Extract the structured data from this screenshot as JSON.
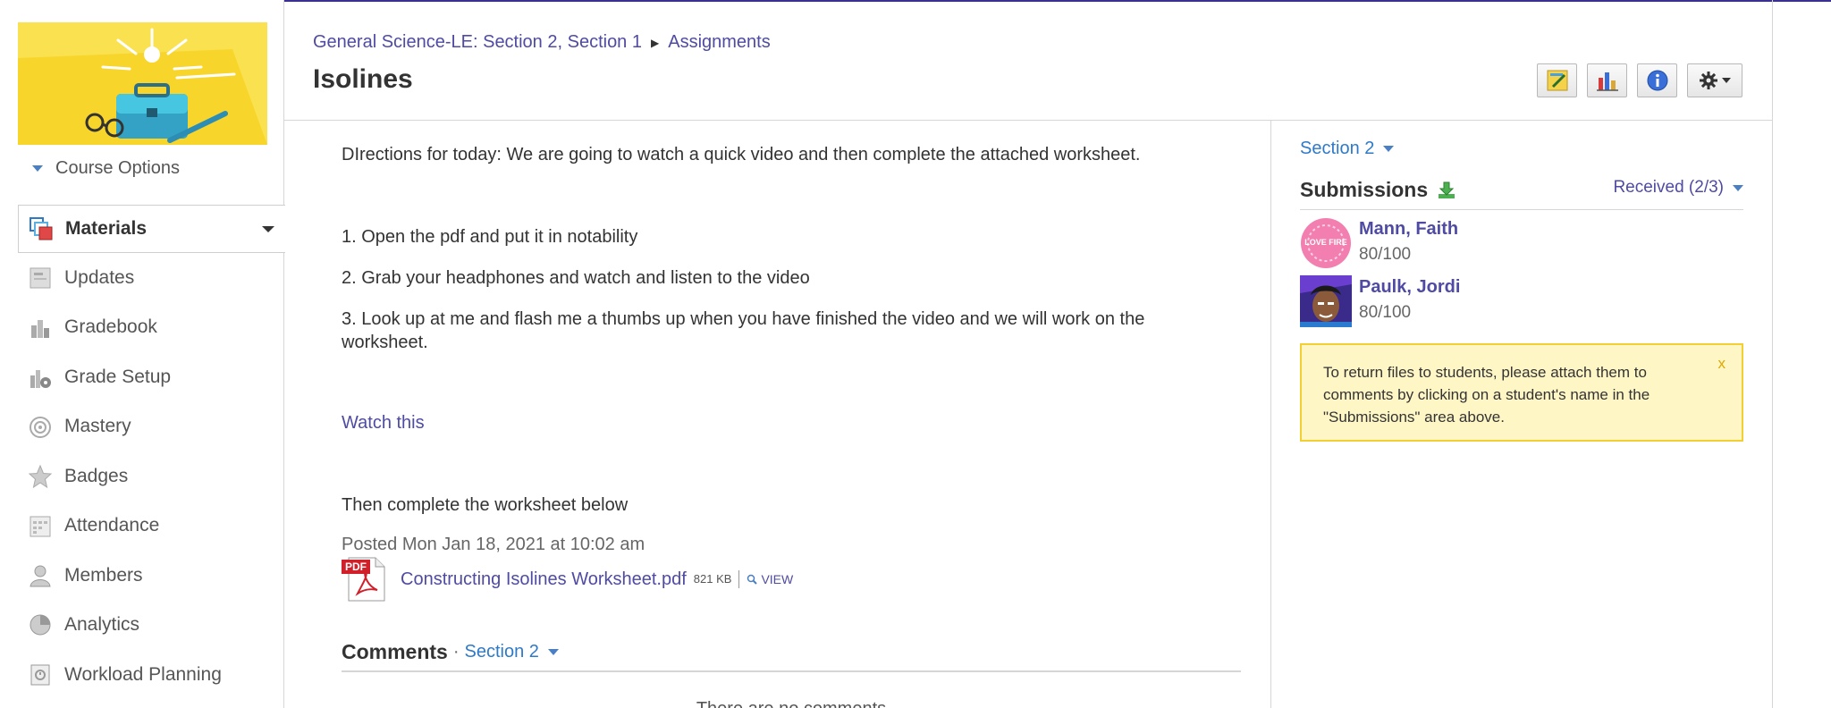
{
  "sidebar": {
    "course_options_label": "Course Options",
    "items": [
      {
        "label": "Materials",
        "icon": "materials-icon",
        "active": true
      },
      {
        "label": "Updates",
        "icon": "updates-icon"
      },
      {
        "label": "Gradebook",
        "icon": "gradebook-icon"
      },
      {
        "label": "Grade Setup",
        "icon": "grade-setup-icon"
      },
      {
        "label": "Mastery",
        "icon": "mastery-icon"
      },
      {
        "label": "Badges",
        "icon": "badges-icon"
      },
      {
        "label": "Attendance",
        "icon": "attendance-icon"
      },
      {
        "label": "Members",
        "icon": "members-icon"
      },
      {
        "label": "Analytics",
        "icon": "analytics-icon"
      },
      {
        "label": "Workload Planning",
        "icon": "workload-planning-icon"
      }
    ]
  },
  "breadcrumb": {
    "course": "General Science-LE: Section 2, Section 1",
    "separator": "▶",
    "current": "Assignments"
  },
  "page_title": "Isolines",
  "toolbar": {
    "buttons": [
      "edit-icon",
      "chart-icon",
      "info-icon",
      "gear-icon"
    ]
  },
  "assignment": {
    "directions": "DIrections for today:  We are going to watch a quick video and then complete the attached worksheet.",
    "steps": [
      "1.  Open the pdf and put it in notability",
      "2.  Grab your headphones and watch and listen to the video",
      "3.  Look up at me and flash me a thumbs up when you have finished the video and we will work on the worksheet."
    ],
    "watch_link": "Watch this",
    "then_text": "Then complete the worksheet below",
    "posted": "Posted Mon Jan 18, 2021 at 10:02 am",
    "attachment": {
      "icon_label": "PDF",
      "filename": "Constructing Isolines Worksheet.pdf",
      "size": "821 KB",
      "view_label": "VIEW"
    }
  },
  "comments": {
    "title": "Comments",
    "separator": "·",
    "section": "Section 2",
    "empty_text": "There are no comments"
  },
  "right_panel": {
    "section": "Section 2",
    "submissions_title": "Submissions",
    "received": "Received (2/3)",
    "submissions": [
      {
        "name": "Mann, Faith",
        "score": "80/100",
        "avatar_text": "LOVE FIRE"
      },
      {
        "name": "Paulk, Jordi",
        "score": "80/100"
      }
    ],
    "notice": "To return files to students, please attach them to comments by clicking on a student's name in the \"Submissions\" area above.",
    "notice_close": "x"
  },
  "colors": {
    "link": "#4f4ba3",
    "section_blue": "#2f7ac8",
    "notice_bg": "#fff6c6",
    "notice_border": "#f2cf32",
    "course_image_bg": "#fae150"
  }
}
